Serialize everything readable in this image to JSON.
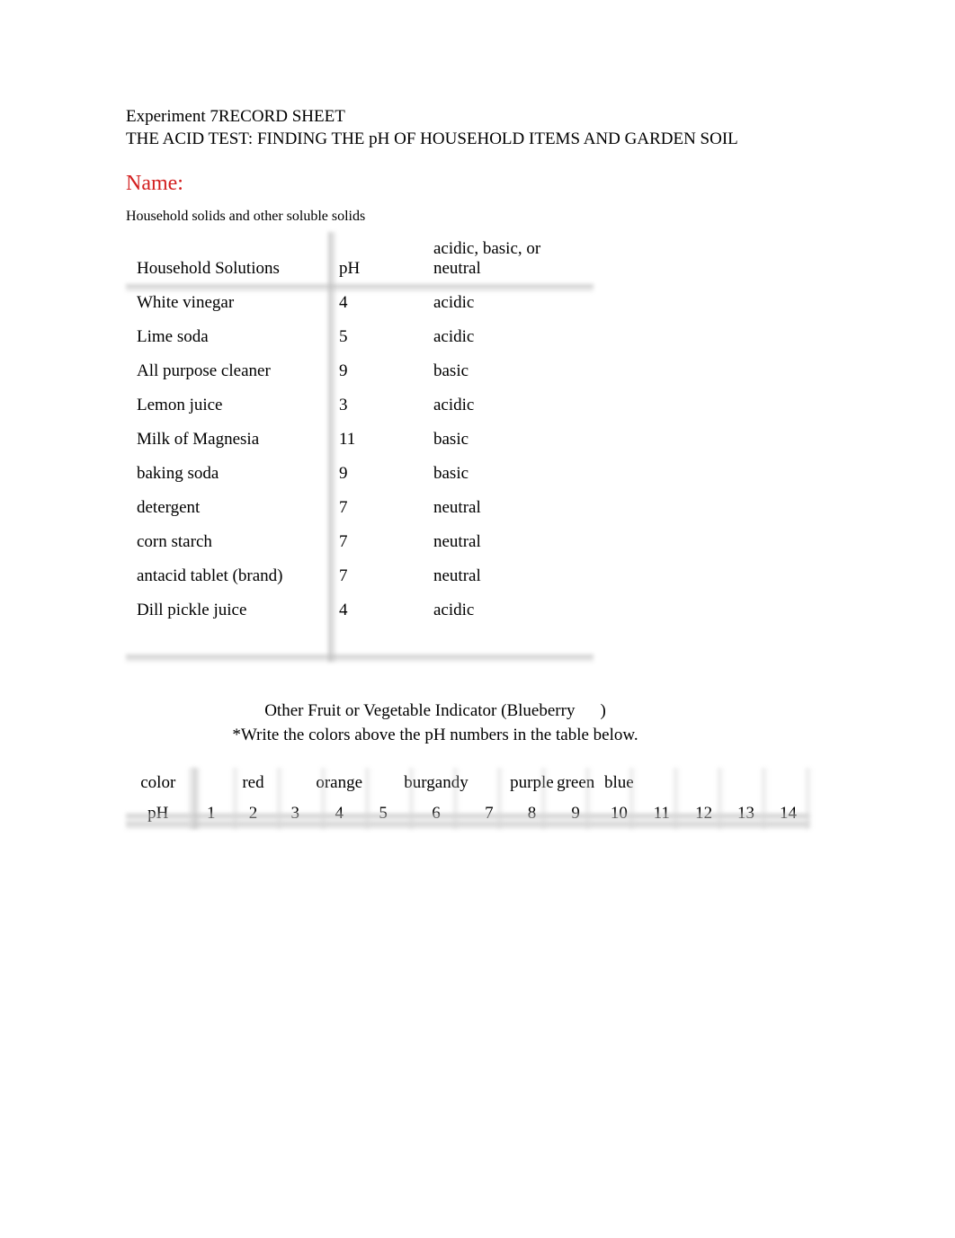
{
  "header": {
    "line1": "Experiment 7RECORD SHEET",
    "line2": "THE ACID TEST: FINDING THE pH OF HOUSEHOLD ITEMS AND GARDEN SOIL"
  },
  "name_label": "Name:",
  "subhead": "Household solids and other soluble solids",
  "table1": {
    "headers": {
      "solutions": "Household Solutions",
      "ph": "pH",
      "classification": "acidic, basic, or neutral"
    },
    "rows": [
      {
        "name": "White vinegar",
        "ph": "4",
        "cls": "acidic"
      },
      {
        "name": "Lime soda",
        "ph": "5",
        "cls": "acidic"
      },
      {
        "name": "All purpose cleaner",
        "ph": "9",
        "cls": "basic"
      },
      {
        "name": "Lemon juice",
        "ph": "3",
        "cls": "acidic"
      },
      {
        "name": "Milk of Magnesia",
        "ph": "11",
        "cls": "basic"
      },
      {
        "name": "baking soda",
        "ph": "9",
        "cls": "basic"
      },
      {
        "name": "detergent",
        "ph": "7",
        "cls": "neutral"
      },
      {
        "name": "corn starch",
        "ph": "7",
        "cls": "neutral"
      },
      {
        "name": "antacid tablet (brand)",
        "ph": "7",
        "cls": "neutral"
      },
      {
        "name": "Dill pickle juice",
        "ph": "4",
        "cls": "acidic"
      },
      {
        "name": "",
        "ph": "",
        "cls": ""
      }
    ]
  },
  "indicator": {
    "caption_prefix": "Other Fruit or Vegetable Indicator (",
    "caption_value": "Blueberry",
    "caption_suffix": ")",
    "instruction": "*Write the colors above the pH numbers in the table below."
  },
  "ph_table": {
    "row_labels": {
      "color": "color",
      "ph": "pH"
    },
    "cells": [
      {
        "ph": "1",
        "color": ""
      },
      {
        "ph": "2",
        "color": "red"
      },
      {
        "ph": "3",
        "color": ""
      },
      {
        "ph": "4",
        "color": "orange"
      },
      {
        "ph": "5",
        "color": ""
      },
      {
        "ph": "6",
        "color": "burgandy"
      },
      {
        "ph": "7",
        "color": ""
      },
      {
        "ph": "8",
        "color": "purple"
      },
      {
        "ph": "9",
        "color": "green"
      },
      {
        "ph": "10",
        "color": "blue"
      },
      {
        "ph": "11",
        "color": ""
      },
      {
        "ph": "12",
        "color": ""
      },
      {
        "ph": "13",
        "color": ""
      },
      {
        "ph": "14",
        "color": ""
      }
    ]
  }
}
